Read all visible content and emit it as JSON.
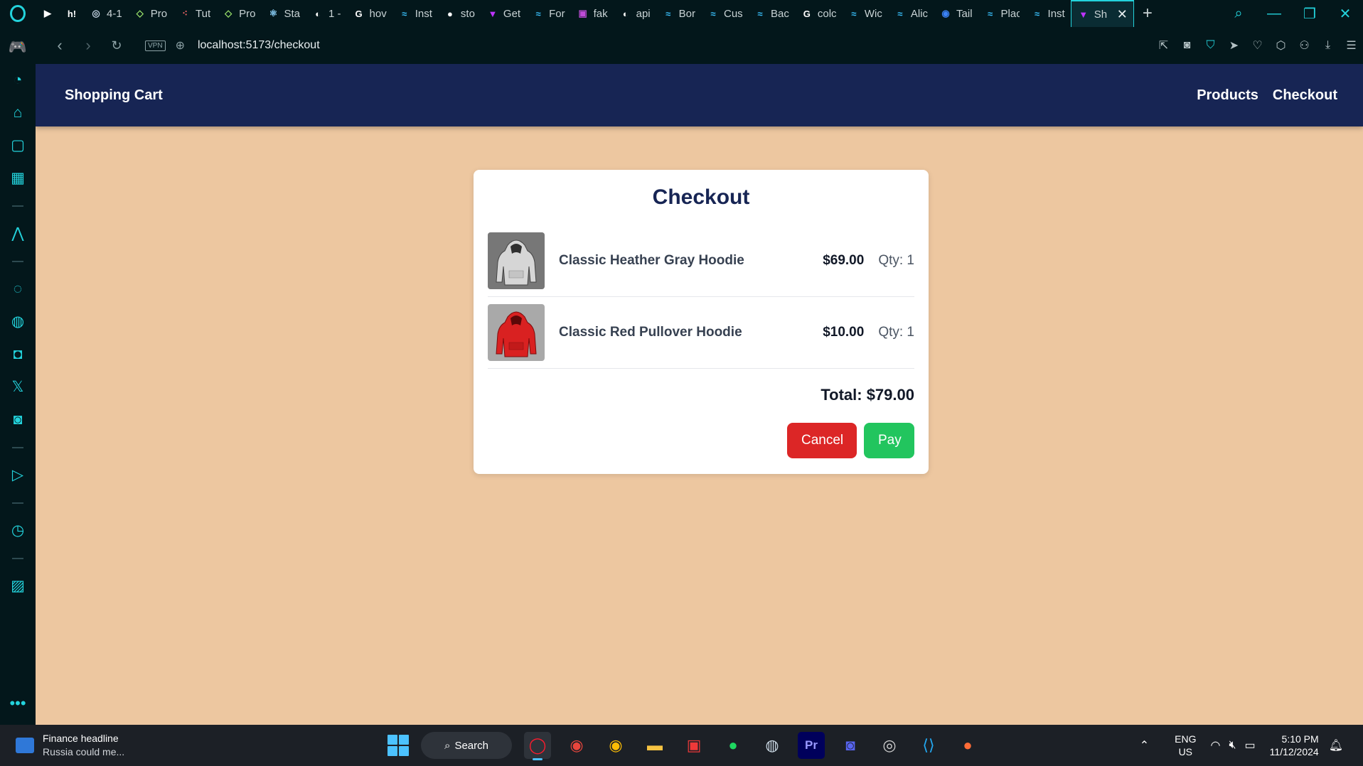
{
  "browser": {
    "tabs": [
      {
        "icon": "play-icon",
        "glyph": "▶",
        "color": "#ffffff",
        "label": ""
      },
      {
        "icon": "hashnode-icon",
        "glyph": "h!",
        "color": "#ffffff",
        "label": ""
      },
      {
        "icon": "chrome-icon",
        "glyph": "◎",
        "color": "#c0d0e0",
        "label": "4-1"
      },
      {
        "icon": "diamond-icon",
        "glyph": "◇",
        "color": "#9be36b",
        "label": "Pro"
      },
      {
        "icon": "dots-icon",
        "glyph": "⁖",
        "color": "#ff6b6b",
        "label": "Tut"
      },
      {
        "icon": "diamond-icon",
        "glyph": "◇",
        "color": "#9be36b",
        "label": "Pro"
      },
      {
        "icon": "react-icon",
        "glyph": "⚛",
        "color": "#8fd6ff",
        "label": "Sta"
      },
      {
        "icon": "globe-icon",
        "glyph": "◐",
        "color": "#ffffff",
        "label": "1 -"
      },
      {
        "icon": "google-icon",
        "glyph": "G",
        "color": "#ffffff",
        "label": "hov"
      },
      {
        "icon": "tailwind-icon",
        "glyph": "≈",
        "color": "#38bdf8",
        "label": "Inst"
      },
      {
        "icon": "github-icon",
        "glyph": "●",
        "color": "#ffffff",
        "label": "sto"
      },
      {
        "icon": "vite-icon",
        "glyph": "▼",
        "color": "#bd34fe",
        "label": "Get"
      },
      {
        "icon": "tailwind-icon",
        "glyph": "≈",
        "color": "#38bdf8",
        "label": "For"
      },
      {
        "icon": "fake-store-icon",
        "glyph": "▣",
        "color": "#c04bd8",
        "label": "fak"
      },
      {
        "icon": "globe-icon",
        "glyph": "◐",
        "color": "#ffffff",
        "label": "api"
      },
      {
        "icon": "tailwind-icon",
        "glyph": "≈",
        "color": "#38bdf8",
        "label": "Bor"
      },
      {
        "icon": "tailwind-icon",
        "glyph": "≈",
        "color": "#38bdf8",
        "label": "Cus"
      },
      {
        "icon": "tailwind-icon",
        "glyph": "≈",
        "color": "#38bdf8",
        "label": "Bac"
      },
      {
        "icon": "google-icon",
        "glyph": "G",
        "color": "#ffffff",
        "label": "colc"
      },
      {
        "icon": "tailwind-icon",
        "glyph": "≈",
        "color": "#38bdf8",
        "label": "Wic"
      },
      {
        "icon": "tailwind-icon",
        "glyph": "≈",
        "color": "#38bdf8",
        "label": "Alic"
      },
      {
        "icon": "tailwind-ui-icon",
        "glyph": "◉",
        "color": "#3b82f6",
        "label": "Tail"
      },
      {
        "icon": "tailwind-icon",
        "glyph": "≈",
        "color": "#38bdf8",
        "label": "Plac"
      },
      {
        "icon": "tailwind-icon",
        "glyph": "≈",
        "color": "#38bdf8",
        "label": "Inst"
      }
    ],
    "active_tab": {
      "icon": "vite-icon",
      "glyph": "▼",
      "color": "#bd34fe",
      "label": "Sh"
    },
    "new_tab": "+",
    "url": "localhost:5173/checkout",
    "vpn_label": "VPN"
  },
  "sidebar": {
    "icons": [
      "gamepad-icon",
      "speedometer-icon",
      "briefcase-icon",
      "twitch-icon",
      "chip-icon",
      "sep",
      "aria-icon",
      "sep",
      "messenger-icon",
      "whatsapp-icon",
      "instagram-icon",
      "x-icon",
      "discord-icon",
      "sep",
      "player-icon",
      "sep",
      "history-icon",
      "sep",
      "gallery-icon"
    ],
    "glyphs": [
      "🎮",
      "◔",
      "⌂",
      "▢",
      "▦",
      "",
      "⋀",
      "",
      "◌",
      "◍",
      "◘",
      "𝕏",
      "◙",
      "",
      "▷",
      "",
      "◷",
      "",
      "▨"
    ],
    "more": "•••"
  },
  "app": {
    "brand": "Shopping Cart",
    "nav": {
      "products": "Products",
      "checkout": "Checkout"
    },
    "checkout": {
      "title": "Checkout",
      "items": [
        {
          "name": "Classic Heather Gray Hoodie",
          "price": "$69.00",
          "qty": "Qty: 1",
          "image": "gray-hoodie"
        },
        {
          "name": "Classic Red Pullover Hoodie",
          "price": "$10.00",
          "qty": "Qty: 1",
          "image": "red-hoodie"
        }
      ],
      "total": "Total: $79.00",
      "cancel": "Cancel",
      "pay": "Pay"
    }
  },
  "taskbar": {
    "widget_title": "Finance headline",
    "widget_sub": "Russia could me...",
    "search": "Search",
    "lang_top": "ENG",
    "lang_bottom": "US",
    "time": "5:10 PM",
    "date": "11/12/2024"
  }
}
